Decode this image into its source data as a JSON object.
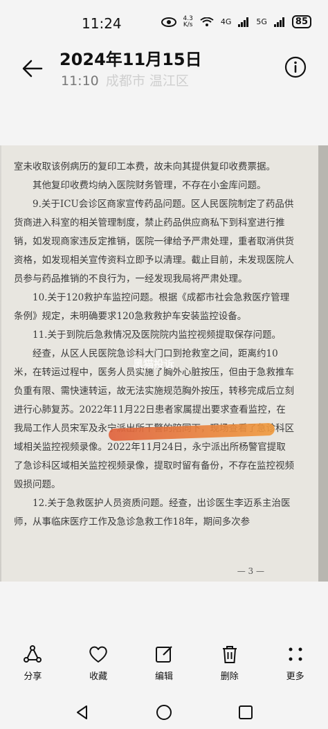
{
  "status_bar": {
    "time": "11:24",
    "net_speed_value": "4.3",
    "net_speed_unit": "K/s",
    "signal_4g": "4G",
    "signal_5g": "5G",
    "battery": "85"
  },
  "header": {
    "title": "2024年11月15日",
    "subtitle_time": "11:10",
    "subtitle_location": "成都市 温江区"
  },
  "photo": {
    "watermark": "黑猫投诉",
    "page_number": "— 3 —",
    "paragraphs": [
      "室未收取该例病历的复印工本费，故未向其提供复印收费票据。",
      "其他复印收费均纳入医院财务管理，不存在小金库问题。",
      "9.关于ICU会诊区商家宣传药品问题。区人民医院制定了药品供货商进入科室的相关管理制度，禁止药品供应商私下到科室进行推销，如发现商家违反定推销，医院一律给予严肃处理，重者取消供货资格，如发现相关宣传资料立即予以清理。截止目前，未发现医院人员参与药品推销的不良行为，一经发现我局将严肃处理。",
      "10.关于120救护车监控问题。根据《成都市社会急救医疗管理条例》规定，未明确要求120急救救护车安装监控设备。",
      "11.关于到院后急救情况及医院院内监控视频提取保存问题。",
      "经查，从区人民医院急诊科大门口到抢救室之间，距离约10米，在转运过程中，医务人员实施了胸外心脏按压，但由于急救推车负重有限、需快速转运，故无法实施规范胸外按压，转移完成后立刻进行心肺复苏。2022年11月22日患者家属提出要求查看监控，在我局工作人员宋军及永宁派出所干警的陪同下，现场查看了急诊科区域相关监控视频录像。2022年11月24日，永宁派出所杨警官提取了急诊科区域相关监控视频录像，提取时留有备份，不存在监控视频毁损问题。",
      "12.关于急救医护人员资质问题。经查，出诊医生李迈系主治医师，从事临床医疗工作及急诊急救工作18年，期间多次参"
    ]
  },
  "toolbar": {
    "share": "分享",
    "favorite": "收藏",
    "edit": "编辑",
    "delete": "删除",
    "more": "更多"
  }
}
